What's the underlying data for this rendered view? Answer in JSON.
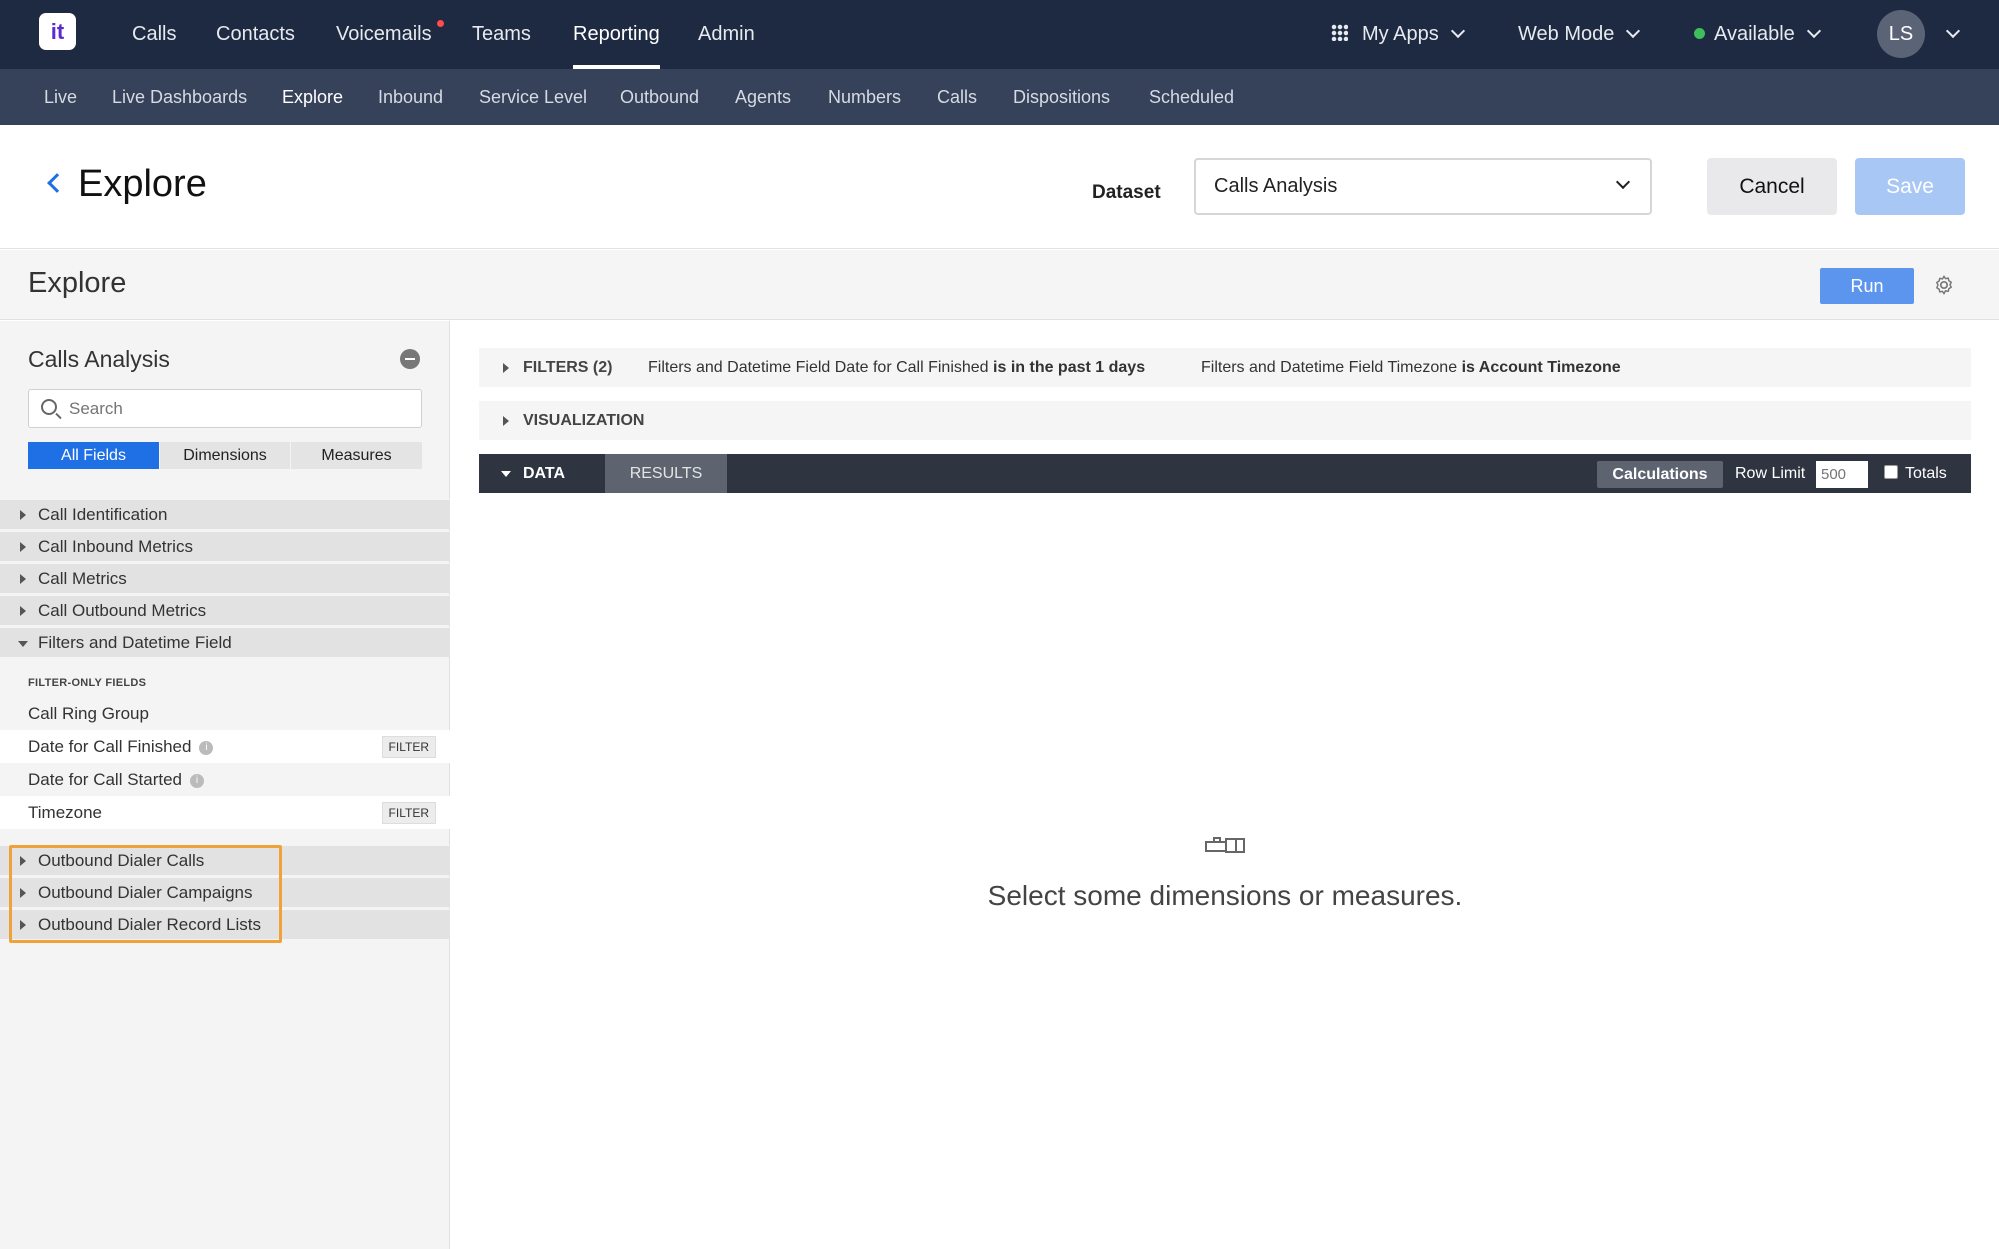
{
  "topnav": {
    "logo_text": "it",
    "items": [
      "Calls",
      "Contacts",
      "Voicemails",
      "Teams",
      "Reporting",
      "Admin"
    ],
    "my_apps": "My Apps",
    "web_mode": "Web Mode",
    "status": "Available",
    "avatar_initials": "LS"
  },
  "subnav": {
    "items": [
      "Live",
      "Live Dashboards",
      "Explore",
      "Inbound",
      "Service Level",
      "Outbound",
      "Agents",
      "Numbers",
      "Calls",
      "Dispositions",
      "Scheduled"
    ]
  },
  "header": {
    "title": "Explore",
    "dataset_label": "Dataset",
    "dataset_value": "Calls Analysis",
    "cancel": "Cancel",
    "save": "Save"
  },
  "explore": {
    "title": "Explore",
    "run": "Run"
  },
  "sidebar": {
    "title": "Calls Analysis",
    "search_placeholder": "Search",
    "segments": [
      "All Fields",
      "Dimensions",
      "Measures"
    ],
    "groups_top": [
      "Call Identification",
      "Call Inbound Metrics",
      "Call Metrics",
      "Call Outbound Metrics",
      "Filters and Datetime Field"
    ],
    "filter_only_heading": "FILTER-ONLY FIELDS",
    "fields": [
      "Call Ring Group",
      "Date for Call Finished",
      "Date for Call Started",
      "Timezone"
    ],
    "filter_tag": "FILTER",
    "info_glyph": "i",
    "groups_bottom": [
      "Outbound Dialer Calls",
      "Outbound Dialer Campaigns",
      "Outbound Dialer Record Lists"
    ]
  },
  "main": {
    "filters_label": "FILTERS (2)",
    "filter1_prefix": "Filters and Datetime Field Date for Call Finished",
    "filter1_value": "is in the past 1 days",
    "filter2_prefix": "Filters and Datetime Field Timezone",
    "filter2_value": "is Account Timezone",
    "visualization_label": "VISUALIZATION",
    "data_tab": "DATA",
    "results_tab": "RESULTS",
    "calculations": "Calculations",
    "row_limit_label": "Row Limit",
    "row_limit_value": "500",
    "totals_label": "Totals",
    "empty_message": "Select some dimensions or measures."
  },
  "colors": {
    "topnav_bg": "#1d2a41",
    "subnav_bg": "#36425a",
    "accent": "#1f6fe5",
    "highlight": "#f0a23a"
  }
}
